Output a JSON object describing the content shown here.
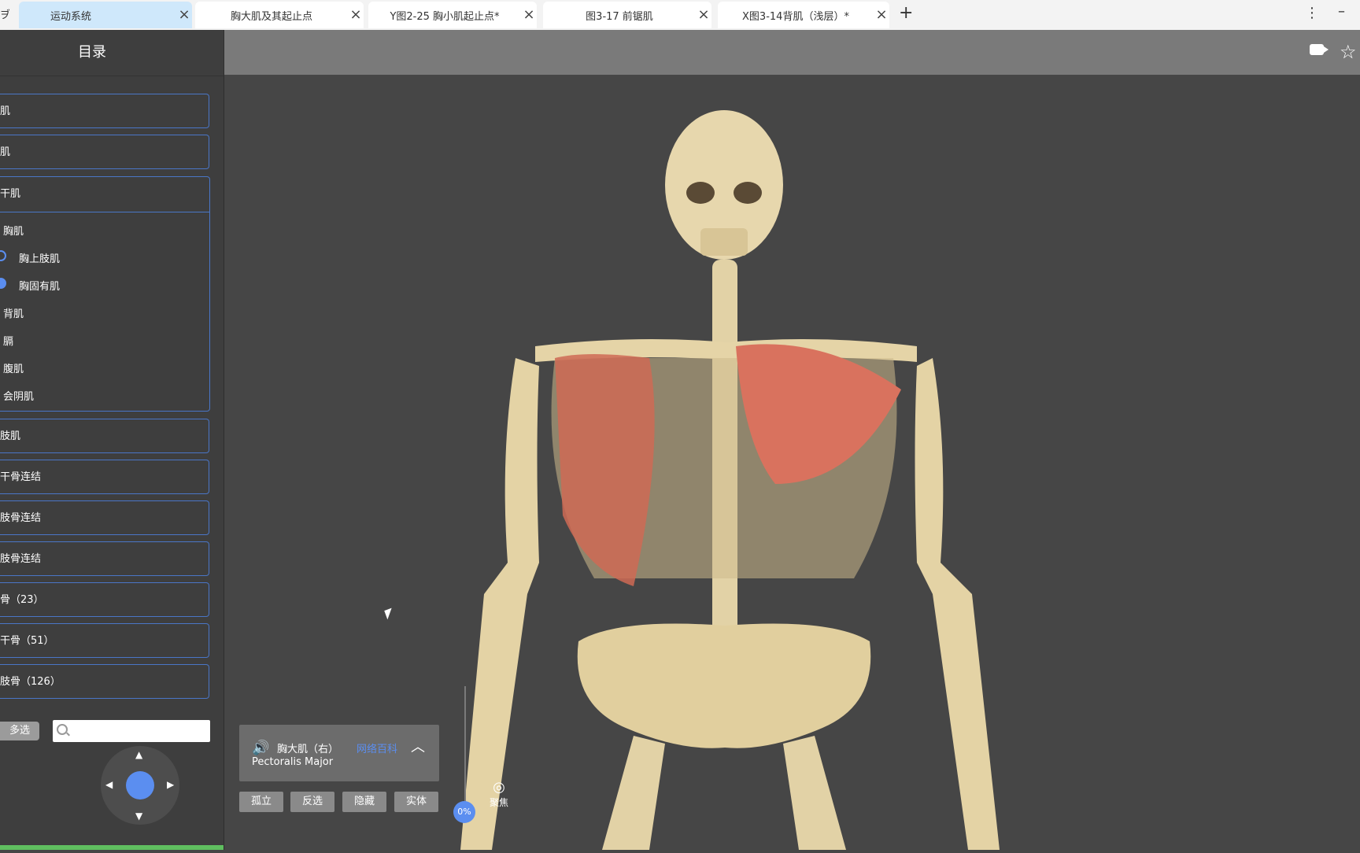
{
  "tabs": [
    {
      "label": "运动系统",
      "active": true
    },
    {
      "label": "胸大肌及其起止点"
    },
    {
      "label": "Y图2-25 胸小肌起止点*"
    },
    {
      "label": "图3-17 前锯肌"
    },
    {
      "label": "X图3-14背肌（浅层）*"
    }
  ],
  "window": {
    "new_tab": "+",
    "menu": "⋮",
    "minimize": "–",
    "edge_glyph": "ヺ"
  },
  "sidebar": {
    "title": "目录",
    "items_top": [
      "肌",
      "肌"
    ],
    "expanded": {
      "label": "干肌",
      "children": [
        {
          "label": "胸肌"
        },
        {
          "label": "胸上肢肌",
          "radio": "empty"
        },
        {
          "label": "胸固有肌",
          "radio": "filled"
        },
        {
          "label": "背肌"
        },
        {
          "label": "膈"
        },
        {
          "label": "腹肌"
        },
        {
          "label": "会阴肌"
        }
      ]
    },
    "items_bottom": [
      "肢肌",
      "干骨连结",
      "肢骨连结",
      "肢骨连结",
      "骨（23）",
      "干骨（51）",
      "肢骨（126）"
    ],
    "multiselect": "多选",
    "search_placeholder": ""
  },
  "info_panel": {
    "name_cn": "胸大肌（右）",
    "link": "网络百科",
    "name_en": "Pectoralis Major"
  },
  "actions": [
    "孤立",
    "反选",
    "隐藏",
    "实体"
  ],
  "progress": "0%",
  "focus_label": "聚焦",
  "colors": {
    "accent": "#5b8ef0",
    "active_tab": "#cfe8fb",
    "sidebar": "#3e3e3e",
    "viewport": "#464646"
  }
}
